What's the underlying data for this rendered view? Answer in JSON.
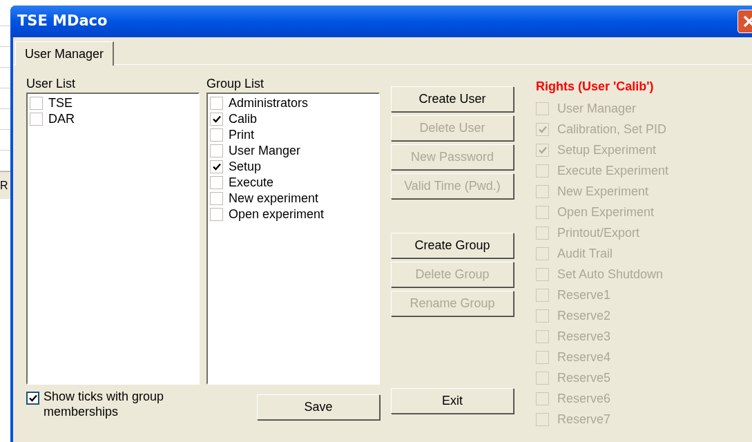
{
  "background": {
    "button": "R"
  },
  "window": {
    "title": "TSE MDaco"
  },
  "tabs": [
    {
      "label": "User Manager",
      "selected": true
    }
  ],
  "user_list": {
    "label": "User List",
    "items": [
      {
        "label": "TSE",
        "checked": false
      },
      {
        "label": "DAR",
        "checked": false
      }
    ]
  },
  "group_list": {
    "label": "Group List",
    "items": [
      {
        "label": "Administrators",
        "checked": false
      },
      {
        "label": "Calib",
        "checked": true
      },
      {
        "label": "Print",
        "checked": false
      },
      {
        "label": "User Manger",
        "checked": false
      },
      {
        "label": "Setup",
        "checked": true
      },
      {
        "label": "Execute",
        "checked": false
      },
      {
        "label": "New experiment",
        "checked": false
      },
      {
        "label": "Open experiment",
        "checked": false
      }
    ]
  },
  "user_buttons": [
    {
      "label": "Create User",
      "disabled": false
    },
    {
      "label": "Delete User",
      "disabled": true
    },
    {
      "label": "New Password",
      "disabled": true
    },
    {
      "label": "Valid Time (Pwd.)",
      "disabled": true
    }
  ],
  "group_buttons": [
    {
      "label": "Create Group",
      "disabled": false
    },
    {
      "label": "Delete Group",
      "disabled": true
    },
    {
      "label": "Rename Group",
      "disabled": true
    }
  ],
  "show_ticks": {
    "label": "Show ticks with group memberships",
    "checked": true
  },
  "save_button": "Save",
  "exit_button": "Exit",
  "rights": {
    "title": "Rights (User 'Calib')",
    "items": [
      {
        "label": "User Manager",
        "checked": false,
        "disabled": true
      },
      {
        "label": "Calibration, Set PID",
        "checked": true,
        "disabled": true
      },
      {
        "label": "Setup Experiment",
        "checked": true,
        "disabled": true
      },
      {
        "label": "Execute Experiment",
        "checked": false,
        "disabled": true
      },
      {
        "label": "New Experiment",
        "checked": false,
        "disabled": true
      },
      {
        "label": "Open Experiment",
        "checked": false,
        "disabled": true
      },
      {
        "label": "Printout/Export",
        "checked": false,
        "disabled": true
      },
      {
        "label": "Audit Trail",
        "checked": false,
        "disabled": true
      },
      {
        "label": "Set Auto Shutdown",
        "checked": false,
        "disabled": true
      },
      {
        "label": "Reserve1",
        "checked": false,
        "disabled": true
      },
      {
        "label": "Reserve2",
        "checked": false,
        "disabled": true
      },
      {
        "label": "Reserve3",
        "checked": false,
        "disabled": true
      },
      {
        "label": "Reserve4",
        "checked": false,
        "disabled": true
      },
      {
        "label": "Reserve5",
        "checked": false,
        "disabled": true
      },
      {
        "label": "Reserve6",
        "checked": false,
        "disabled": true
      },
      {
        "label": "Reserve7",
        "checked": false,
        "disabled": true
      }
    ]
  }
}
